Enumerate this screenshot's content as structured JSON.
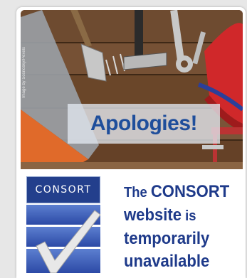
{
  "hero": {
    "headline": "Apologies!",
    "photo_credit": "Image by Sosnosky/Pexels"
  },
  "logo": {
    "label": "CONSORT"
  },
  "message": {
    "line1_pre": "The ",
    "line1_brand": "CONSORT",
    "line2_word": "website",
    "line2_small": " is",
    "line3": "temporarily",
    "line4": "unavailable"
  },
  "colors": {
    "brand_blue": "#1e3a8a",
    "logo_navy": "#233f8c",
    "wood": "#6b4a2e"
  }
}
